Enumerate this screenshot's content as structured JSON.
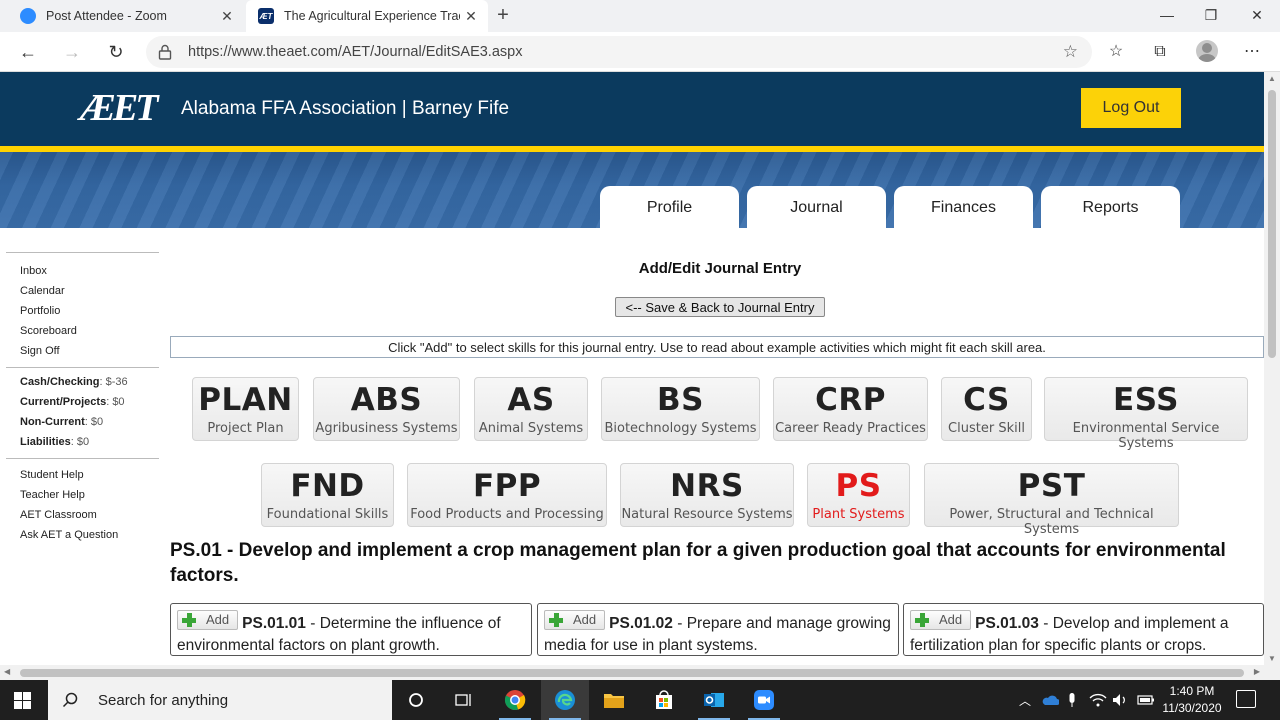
{
  "browser": {
    "tabs": [
      {
        "title": "Post Attendee - Zoom",
        "favicon": "zoom-icon"
      },
      {
        "title": "The Agricultural Experience Track",
        "favicon": "aet-icon"
      }
    ],
    "url": "https://www.theaet.com/AET/Journal/EditSAE3.aspx"
  },
  "header": {
    "logo": "ÆET",
    "title": "Alabama FFA Association | Barney Fife",
    "logout": "Log Out"
  },
  "main_tabs": [
    "Profile",
    "Journal",
    "Finances",
    "Reports"
  ],
  "sidebar": {
    "links": [
      "Inbox",
      "Calendar",
      "Portfolio",
      "Scoreboard",
      "Sign Off"
    ],
    "finance": [
      {
        "label": "Cash/Checking",
        "value": ": $-36"
      },
      {
        "label": "Current/Projects",
        "value": ": $0"
      },
      {
        "label": "Non-Current",
        "value": ": $0"
      },
      {
        "label": "Liabilities",
        "value": ": $0"
      }
    ],
    "help_links": [
      "Student Help",
      "Teacher Help",
      "AET Classroom",
      "Ask AET a Question"
    ]
  },
  "main": {
    "title": "Add/Edit Journal Entry",
    "save_button": "<-- Save & Back to Journal Entry",
    "instructions": "Click \"Add\" to select skills for this journal entry. Use to read about example activities which might fit each skill area.",
    "categories_row1": [
      {
        "code": "PLAN",
        "name": "Project Plan"
      },
      {
        "code": "ABS",
        "name": "Agribusiness Systems"
      },
      {
        "code": "AS",
        "name": "Animal Systems"
      },
      {
        "code": "BS",
        "name": "Biotechnology Systems"
      },
      {
        "code": "CRP",
        "name": "Career Ready Practices"
      },
      {
        "code": "CS",
        "name": "Cluster Skill"
      },
      {
        "code": "ESS",
        "name": "Environmental Service Systems"
      }
    ],
    "categories_row2": [
      {
        "code": "FND",
        "name": "Foundational Skills"
      },
      {
        "code": "FPP",
        "name": "Food Products and Processing"
      },
      {
        "code": "NRS",
        "name": "Natural Resource Systems"
      },
      {
        "code": "PS",
        "name": "Plant Systems",
        "active": true
      },
      {
        "code": "PST",
        "name": "Power, Structural and Technical Systems"
      }
    ],
    "standard_heading": "PS.01 - Develop and implement a crop management plan for a given production goal that accounts for environmental factors.",
    "add_label": "Add",
    "skills": [
      {
        "code": "PS.01.01",
        "text": " - Determine the influence of environmental factors on plant growth."
      },
      {
        "code": "PS.01.02",
        "text": " - Prepare and manage growing media for use in plant systems."
      },
      {
        "code": "PS.01.03",
        "text": " - Develop and implement a fertilization plan for specific plants or crops."
      }
    ]
  },
  "taskbar": {
    "search_placeholder": "Search for anything",
    "time": "1:40 PM",
    "date": "11/30/2020"
  },
  "colors": {
    "header": "#0b3a5e",
    "accent_yellow": "#ffd200",
    "active_category": "#e21b1b"
  }
}
